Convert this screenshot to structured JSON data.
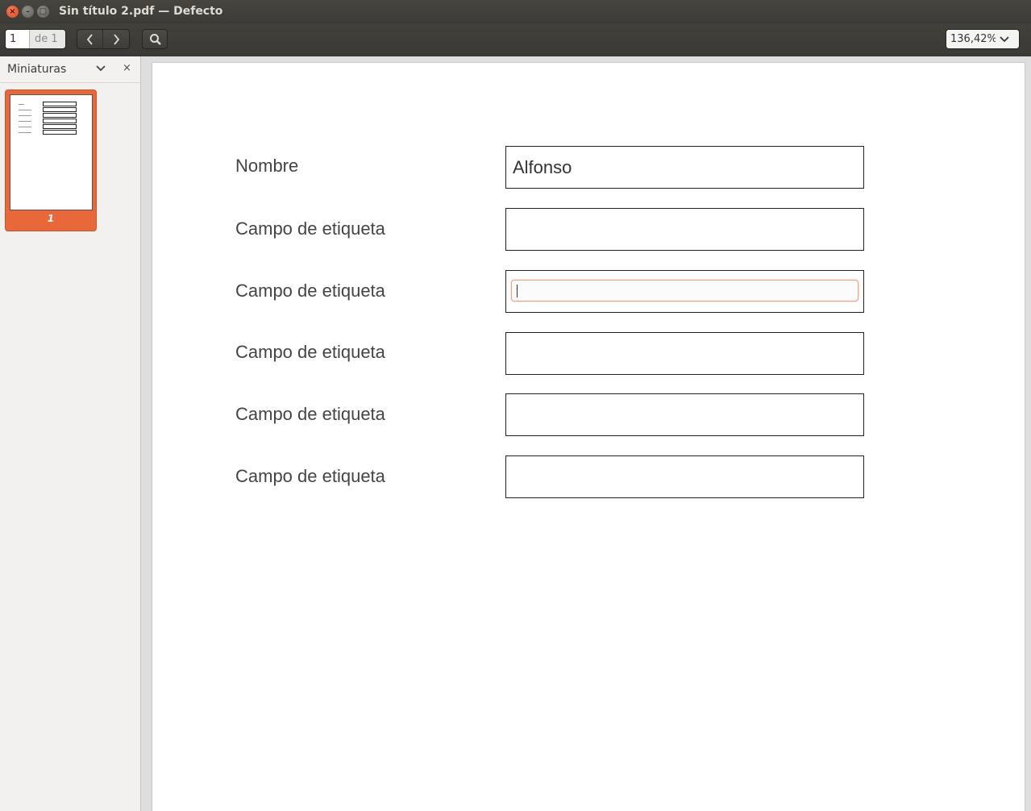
{
  "window": {
    "title": "Sin título 2.pdf — Defecto",
    "close": "×",
    "minimize": "–",
    "maximize": "□"
  },
  "toolbar": {
    "page_value": "1",
    "page_of": "de 1",
    "prev_icon": "‹",
    "next_icon": "›",
    "zoom": "136,42%"
  },
  "sidebar": {
    "title": "Miniaturas",
    "close": "×",
    "thumbnail_label": "1"
  },
  "form": {
    "rows": [
      {
        "label": "Nombre",
        "value": "Alfonso"
      },
      {
        "label": "Campo de etiqueta",
        "value": ""
      },
      {
        "label": "Campo de etiqueta",
        "value": ""
      },
      {
        "label": "Campo de etiqueta",
        "value": ""
      },
      {
        "label": "Campo de etiqueta",
        "value": ""
      },
      {
        "label": "Campo de etiqueta",
        "value": ""
      }
    ]
  },
  "colors": {
    "accent": "#e9683a",
    "titlebar": "#3c3b37"
  }
}
